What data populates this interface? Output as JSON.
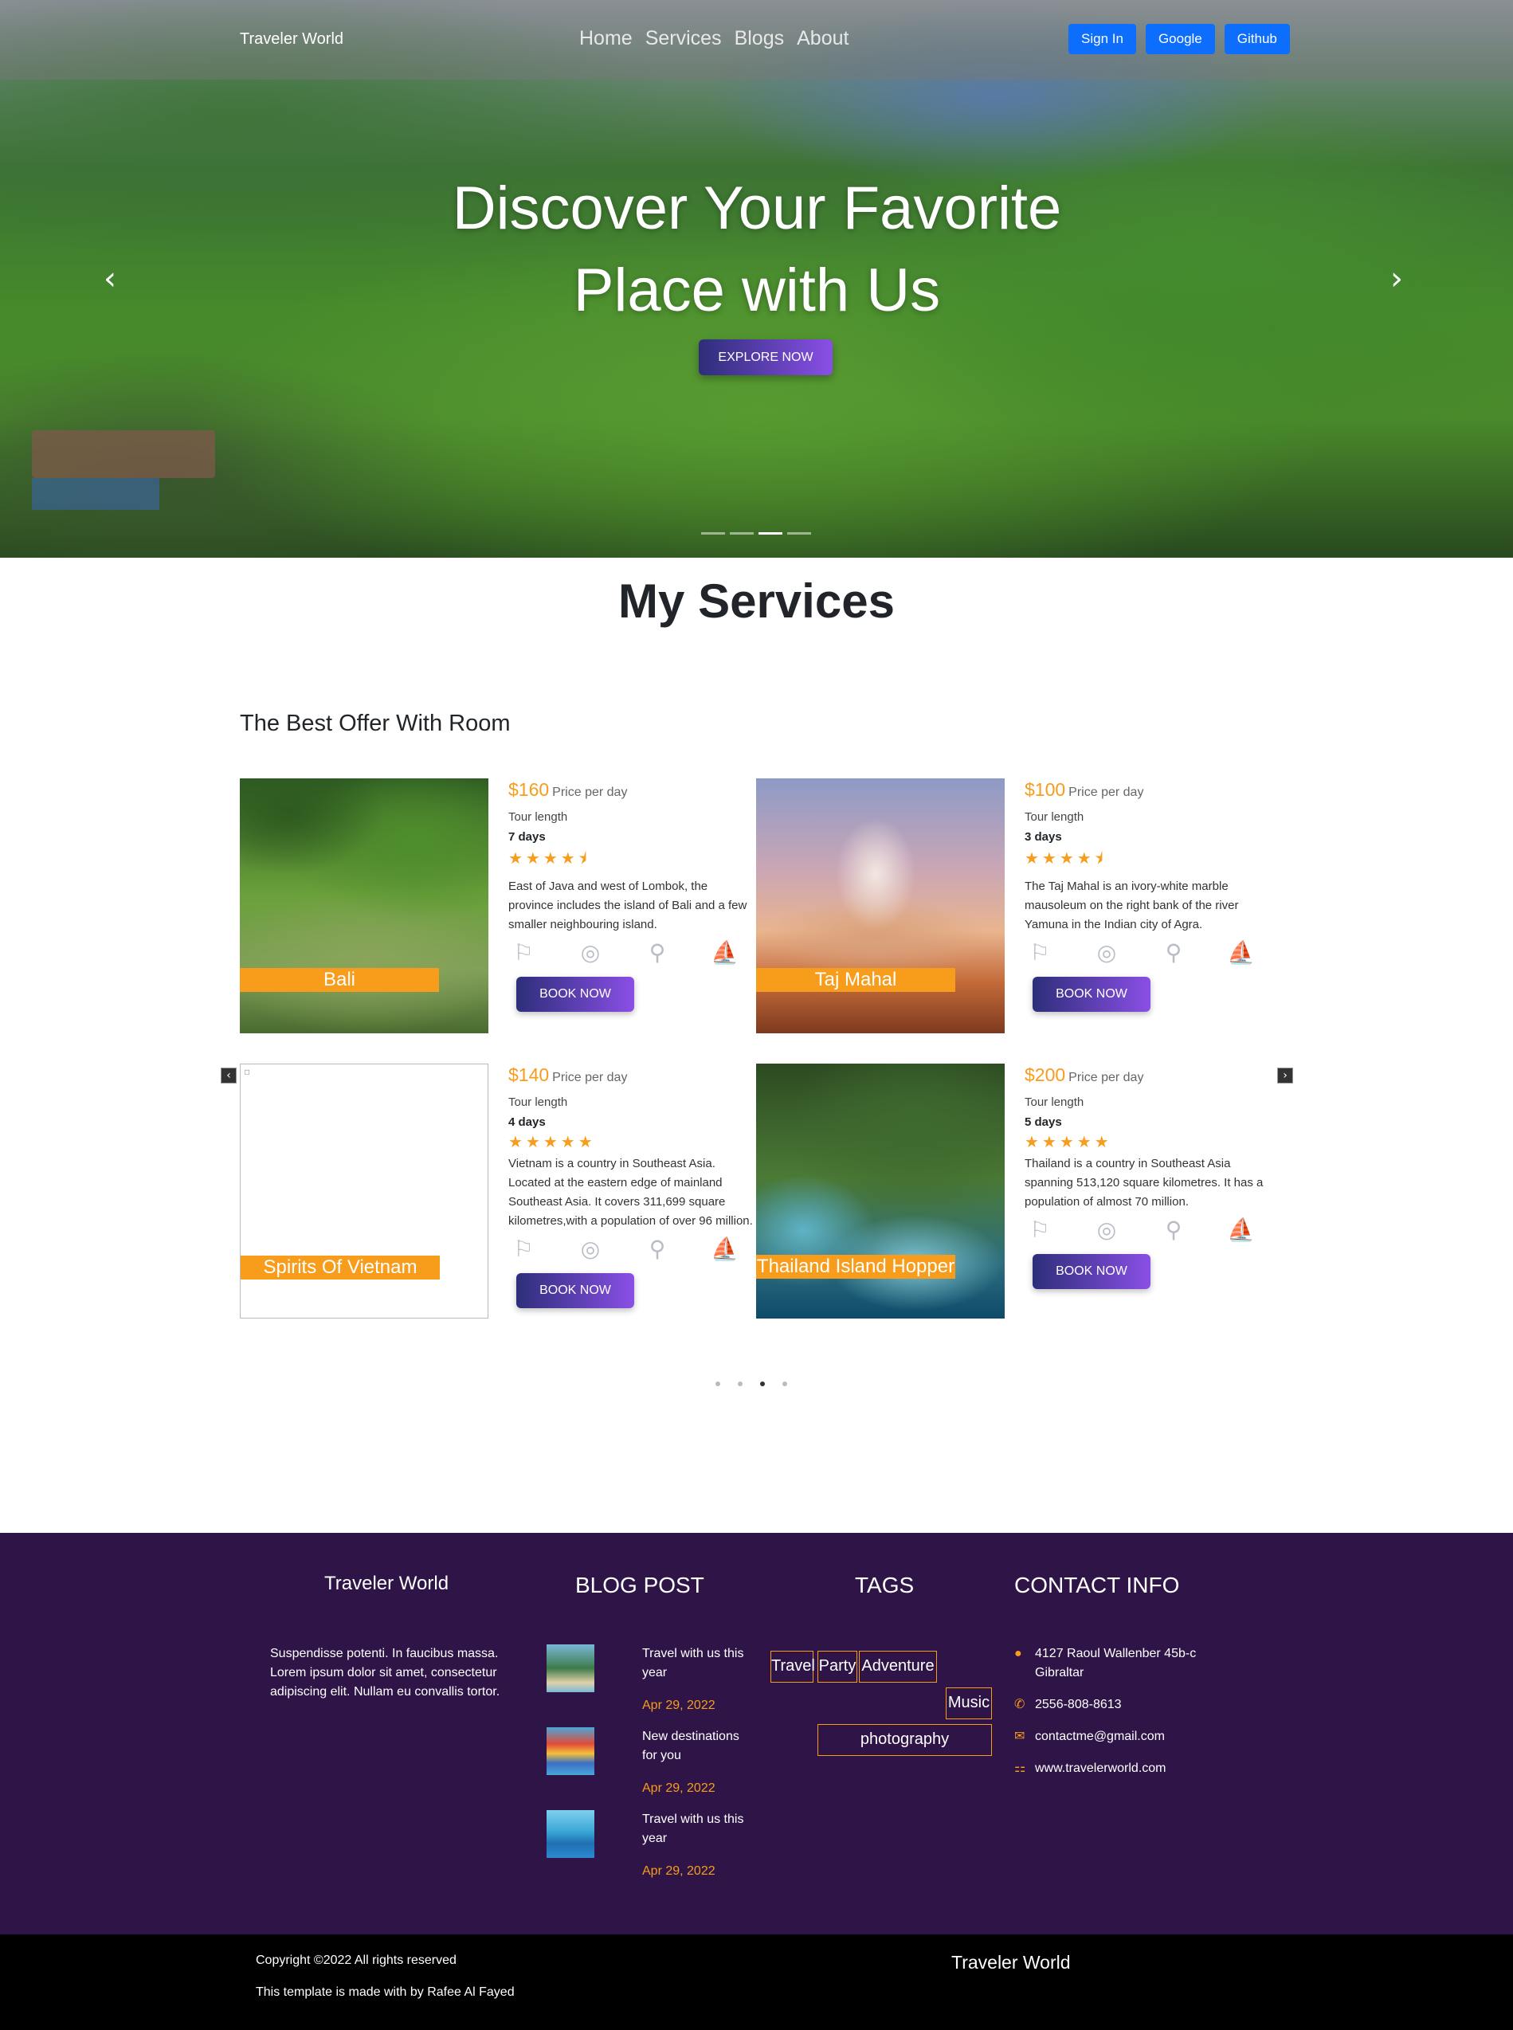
{
  "nav": {
    "brand": "Traveler World",
    "links": [
      "Home",
      "Services",
      "Blogs",
      "About"
    ],
    "buttons": [
      "Sign In",
      "Google",
      "Github"
    ]
  },
  "hero": {
    "title_line1": "Discover Your Favorite",
    "title_line2": "Place with Us",
    "cta": "EXPLORE NOW",
    "prev_icon": "chevron-left-icon",
    "next_icon": "chevron-right-icon",
    "slides": 4,
    "active_slide": 3
  },
  "services": {
    "title": "My Services",
    "subtitle": "The Best Offer With Room",
    "price_unit": "Price per day",
    "tour_length_label": "Tour length",
    "book_label": "BOOK NOW",
    "cards": [
      {
        "name": "Bali",
        "price": "$160",
        "days": "7 days",
        "rating": 4.5,
        "stars": "★★★★⯨",
        "desc": "East of Java and west of Lombok, the province includes the island of Bali and a few smaller neighbouring island."
      },
      {
        "name": "Taj Mahal",
        "price": "$100",
        "days": "3 days",
        "rating": 4.5,
        "stars": "★★★★⯨",
        "desc": "The Taj Mahal is an ivory-white marble mausoleum on the right bank of the river Yamuna in the Indian city of Agra."
      },
      {
        "name": "Spirits Of Vietnam",
        "price": "$140",
        "days": "4 days",
        "rating": 5,
        "stars": "★★★★★",
        "desc": "Vietnam is a country in Southeast Asia. Located at the eastern edge of mainland Southeast Asia. It covers 311,699 square kilometres,with a population of over 96 million."
      },
      {
        "name": "Thailand Island Hopper",
        "price": "$200",
        "days": "5 days",
        "rating": 5,
        "stars": "★★★★★",
        "desc": "Thailand is a country in Southeast Asia spanning 513,120 square kilometres. It has a population of almost 70 million."
      }
    ],
    "amenity_icons": [
      "signpost-icon",
      "compass-icon",
      "bicycle-icon",
      "sailboat-icon"
    ],
    "pages": 4,
    "active_page": 3
  },
  "footer": {
    "brand": "Traveler World",
    "about": "Suspendisse potenti. In faucibus massa. Lorem ipsum dolor sit amet, consectetur adipiscing elit. Nullam eu convallis tortor.",
    "blog_title": "BLOG POST",
    "posts": [
      {
        "title": "Travel with us this year",
        "date": "Apr 29, 2022"
      },
      {
        "title": "New destinations for you",
        "date": "Apr 29, 2022"
      },
      {
        "title": "Travel with us this year",
        "date": "Apr 29, 2022"
      }
    ],
    "tags_title": "TAGS",
    "tags": [
      "Travel",
      "Party",
      "Adventure",
      "Music",
      "photography"
    ],
    "contact_title": "CONTACT INFO",
    "contact": {
      "address": "4127 Raoul Wallenber 45b-c Gibraltar",
      "phone": "2556-808-8613",
      "email": "contactme@gmail.com",
      "website": "www.travelerworld.com"
    }
  },
  "bottom": {
    "copyright": "Copyright ©2022 All rights reserved",
    "credit": "This template is made with by Rafee Al Fayed",
    "brand": "Traveler World"
  },
  "colors": {
    "accent": "#f89c1c",
    "footer_bg": "#2f1547",
    "nav_button": "#0d6efd",
    "gradient_start": "#2d2e7a",
    "gradient_end": "#8a4fe6"
  }
}
